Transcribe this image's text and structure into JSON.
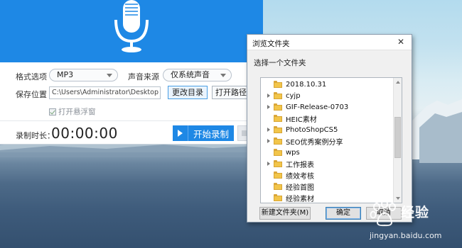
{
  "recorder": {
    "format_label": "格式选项",
    "format_value": "MP3",
    "source_label": "声音来源",
    "source_value": "仅系统声音",
    "save_label": "保存位置",
    "save_path": "C:\\Users\\Administrator\\Desktop",
    "change_dir_label": "更改目录",
    "open_path_label": "打开路径",
    "floating_window_label": "打开悬浮窗",
    "duration_label": "录制时长：",
    "duration_value": "00:00:00",
    "start_label": "开始录制",
    "accent": "#1e88e5"
  },
  "dialog": {
    "title": "浏览文件夹",
    "close_symbol": "✕",
    "prompt": "选择一个文件夹",
    "folders": [
      {
        "name": "2018.10.31",
        "expandable": false
      },
      {
        "name": "cyjp",
        "expandable": true
      },
      {
        "name": "GIF-Release-0703",
        "expandable": true
      },
      {
        "name": "HEIC素材",
        "expandable": false
      },
      {
        "name": "PhotoShopCS5",
        "expandable": true
      },
      {
        "name": "SEO优秀案例分享",
        "expandable": true
      },
      {
        "name": "wps",
        "expandable": false
      },
      {
        "name": "工作报表",
        "expandable": true
      },
      {
        "name": "绩效考核",
        "expandable": false
      },
      {
        "name": "经验首图",
        "expandable": false
      },
      {
        "name": "经验素材",
        "expandable": false
      }
    ],
    "new_folder_label": "新建文件夹(M)",
    "ok_label": "确定",
    "cancel_label": "取消"
  },
  "watermark": {
    "brand": "经验",
    "url": "jingyan.baidu.com"
  }
}
